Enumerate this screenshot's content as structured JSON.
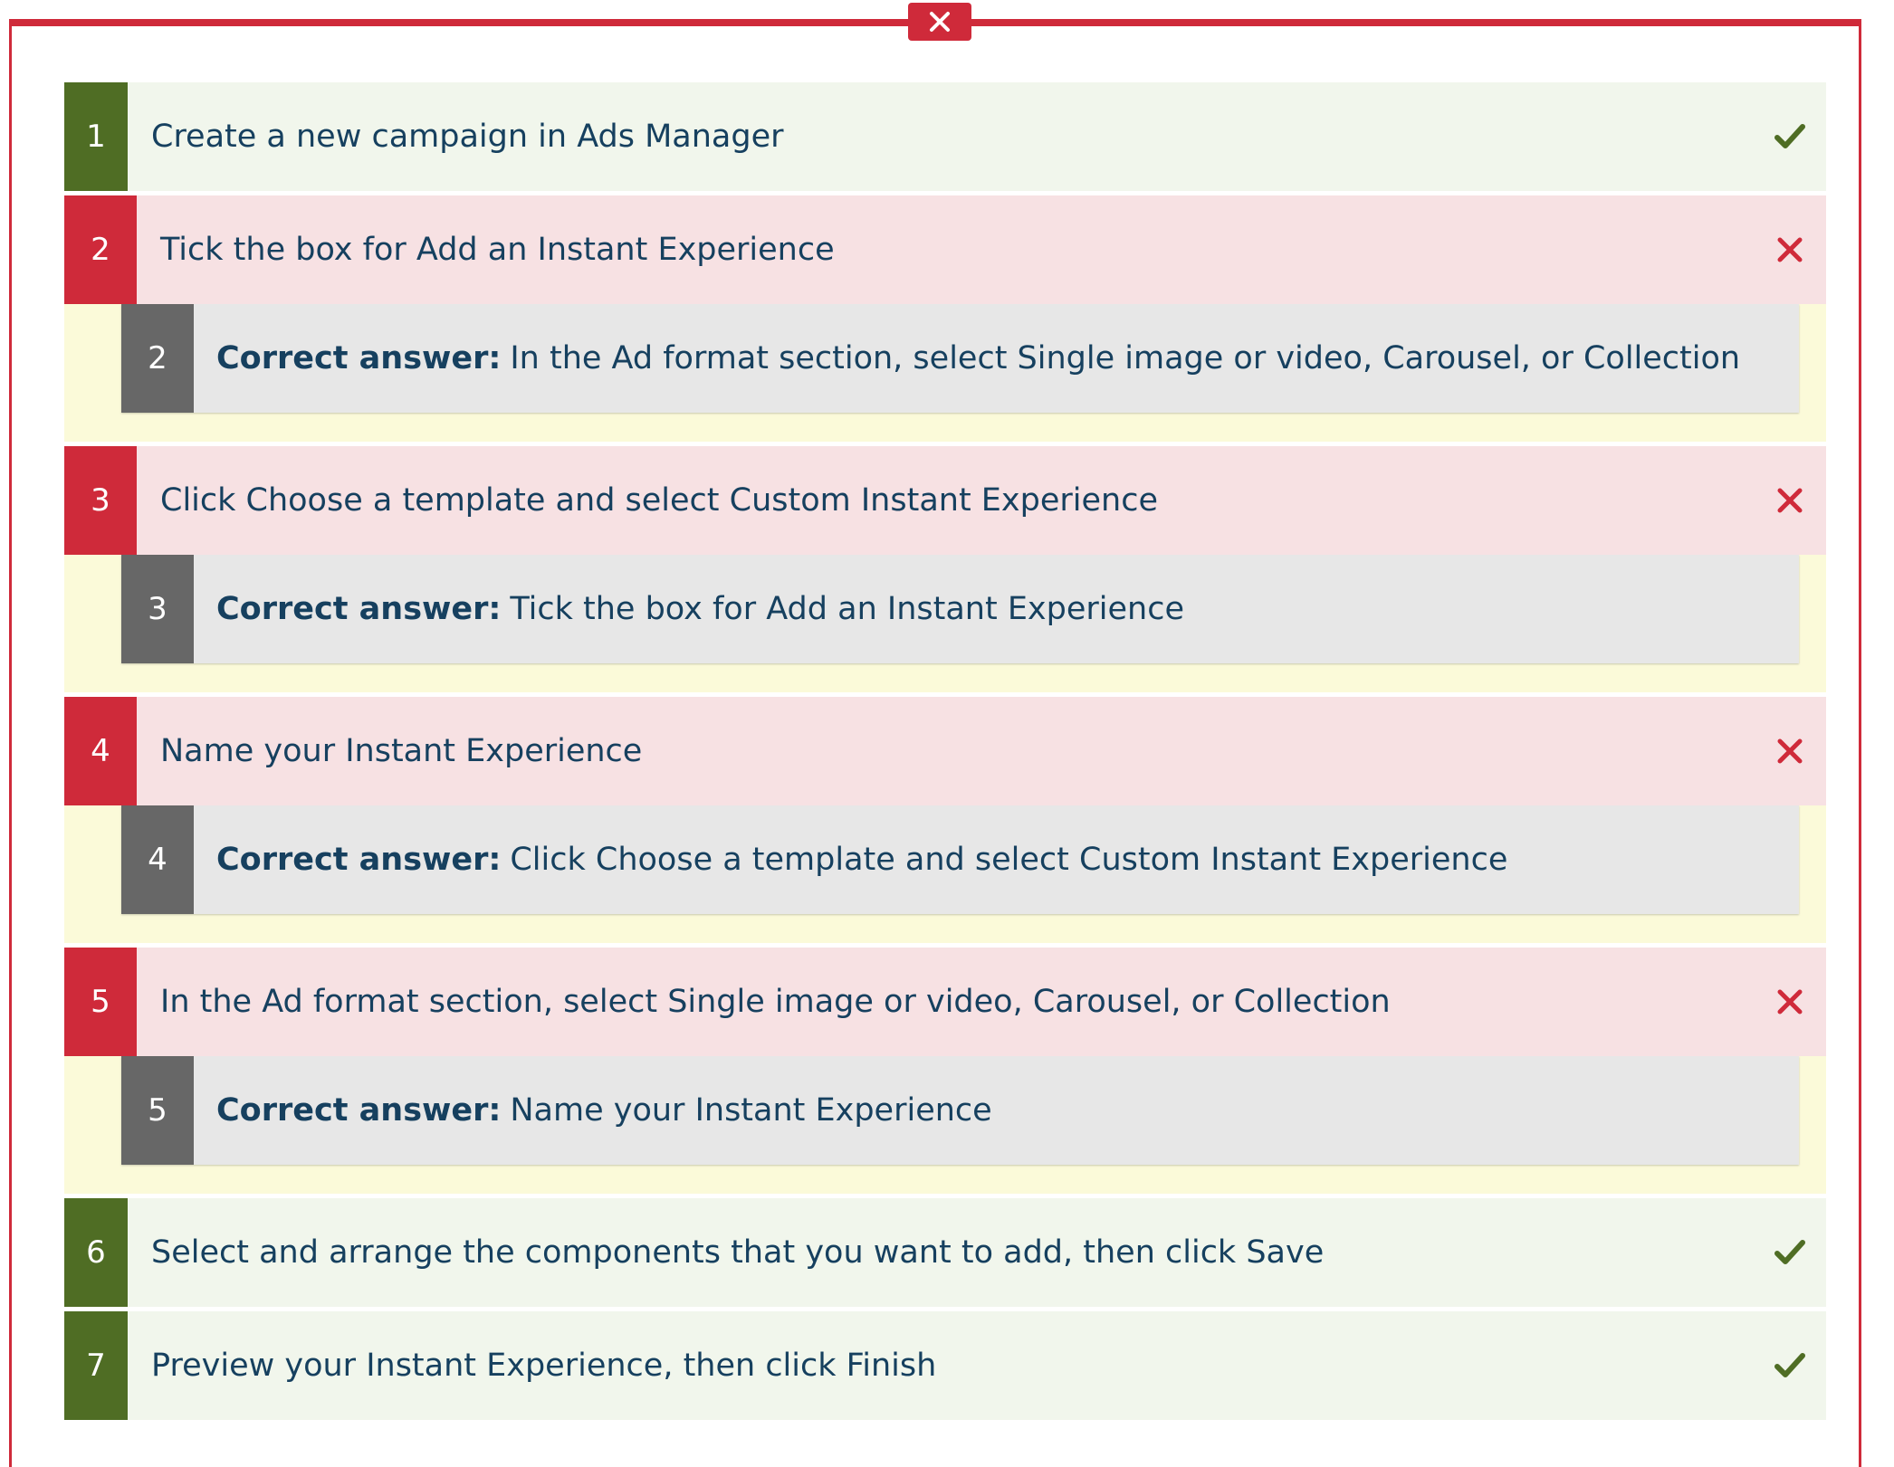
{
  "colors": {
    "accent_red": "#cf2a3a",
    "correct_green": "#4f6d24",
    "answer_grey": "#676767",
    "text": "#16405f"
  },
  "close_icon": "close-icon",
  "answer_prefix": "Correct answer:",
  "steps": [
    {
      "num": "1",
      "text": "Create a new campaign in Ads Manager",
      "status": "correct",
      "status_icon": "check-icon"
    },
    {
      "num": "2",
      "text": "Tick the box for Add an Instant Experience",
      "status": "wrong",
      "status_icon": "cross-icon",
      "answer": {
        "num": "2",
        "text": "In the Ad format section, select Single image or video, Carousel, or Collection"
      }
    },
    {
      "num": "3",
      "text": "Click Choose a template and select Custom Instant Experience",
      "status": "wrong",
      "status_icon": "cross-icon",
      "answer": {
        "num": "3",
        "text": "Tick the box for Add an Instant Experience"
      }
    },
    {
      "num": "4",
      "text": "Name your Instant Experience",
      "status": "wrong",
      "status_icon": "cross-icon",
      "answer": {
        "num": "4",
        "text": "Click Choose a template and select Custom Instant Experience"
      }
    },
    {
      "num": "5",
      "text": "In the Ad format section, select Single image or video, Carousel, or Collection",
      "status": "wrong",
      "status_icon": "cross-icon",
      "answer": {
        "num": "5",
        "text": "Name your Instant Experience"
      }
    },
    {
      "num": "6",
      "text": "Select and arrange the components that you want to add, then click Save",
      "status": "correct",
      "status_icon": "check-icon"
    },
    {
      "num": "7",
      "text": "Preview your Instant Experience, then click Finish",
      "status": "correct",
      "status_icon": "check-icon"
    }
  ]
}
